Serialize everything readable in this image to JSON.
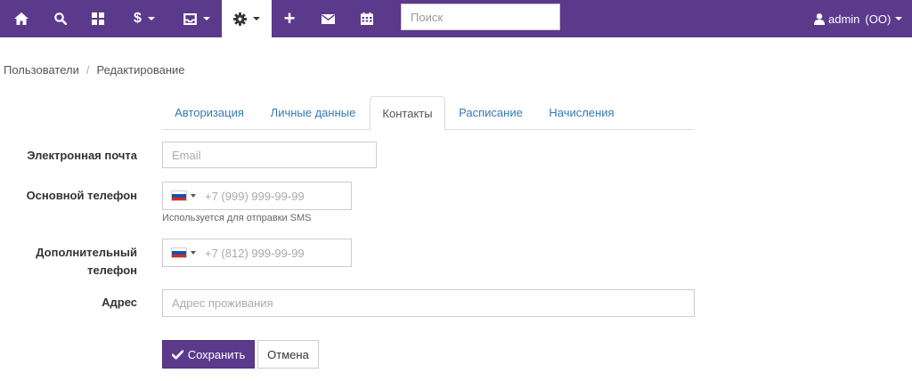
{
  "navbar": {
    "background": "#5b3a8c",
    "items": [
      {
        "icon": "home-icon"
      },
      {
        "icon": "search-icon"
      },
      {
        "icon": "dashboard-grid-icon"
      },
      {
        "icon": "dollar-icon",
        "label": "$",
        "has_caret": true
      },
      {
        "icon": "inbox-icon",
        "has_caret": true
      },
      {
        "icon": "gear-icon",
        "has_caret": true,
        "active": true
      },
      {
        "icon": "plus-icon",
        "label": "+"
      },
      {
        "icon": "envelope-icon"
      },
      {
        "icon": "calendar-icon"
      }
    ],
    "search_placeholder": "Поиск",
    "user": {
      "icon": "user-icon",
      "name": "admin",
      "role": "(ОО)"
    }
  },
  "breadcrumb": {
    "items": [
      "Пользователи",
      "Редактирование"
    ],
    "separator": "/"
  },
  "tabs": [
    {
      "label": "Авторизация",
      "active": false
    },
    {
      "label": "Личные данные",
      "active": false
    },
    {
      "label": "Контакты",
      "active": true
    },
    {
      "label": "Расписание",
      "active": false
    },
    {
      "label": "Начисления",
      "active": false
    }
  ],
  "form": {
    "email": {
      "label": "Электронная почта",
      "placeholder": "Email",
      "value": ""
    },
    "main_phone": {
      "label": "Основной телефон",
      "placeholder": "+7 (999) 999-99-99",
      "value": "",
      "help": "Используется для отправки SMS",
      "flag_icon": "russia-flag-icon"
    },
    "extra_phone": {
      "label_line1": "Дополнительный",
      "label_line2": "телефон",
      "placeholder": "+7 (812) 999-99-99",
      "value": "",
      "flag_icon": "russia-flag-icon"
    },
    "address": {
      "label": "Адрес",
      "placeholder": "Адрес проживания",
      "value": ""
    }
  },
  "actions": {
    "save_label": "Сохранить",
    "save_icon": "check-icon",
    "cancel_label": "Отмена"
  },
  "colors": {
    "primary": "#5b3a8c",
    "link": "#337ab7"
  }
}
